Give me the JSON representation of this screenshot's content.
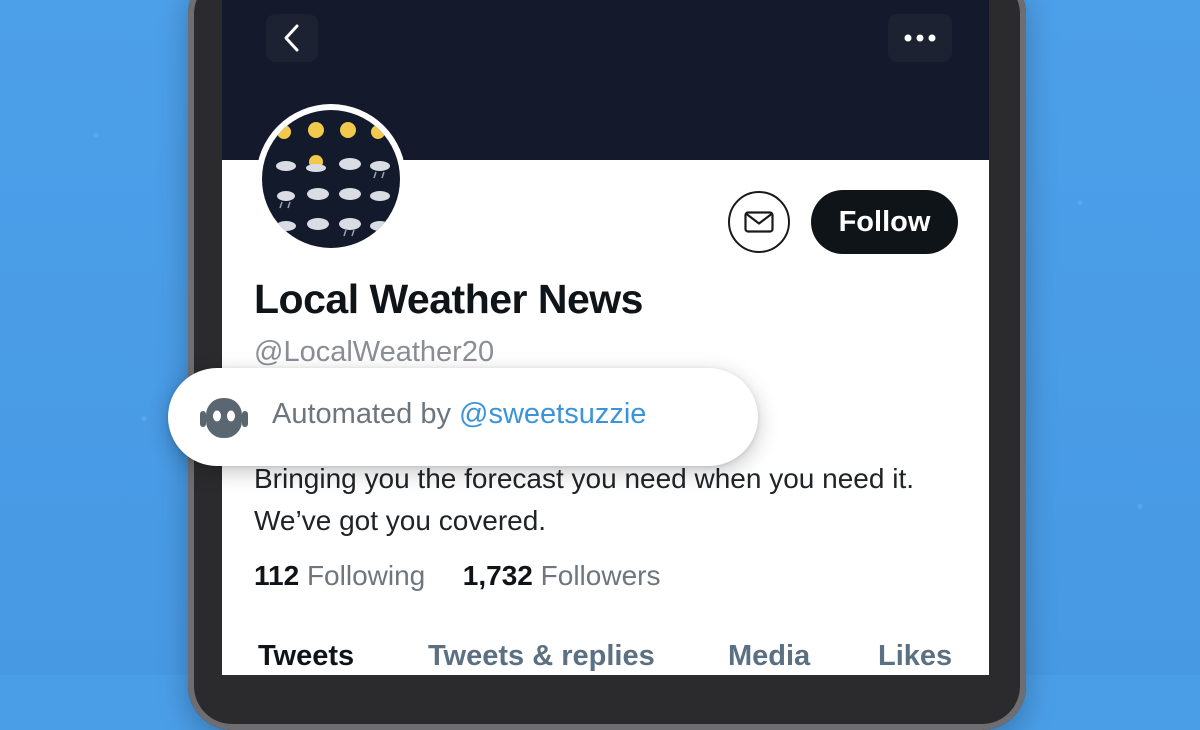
{
  "profile": {
    "name": "Local Weather News",
    "handle": "@LocalWeather20",
    "bio": "Bringing you the forecast you need when you need it.  We’ve got you covered.",
    "follow_label": "Follow"
  },
  "automated": {
    "prefix": "Automated by ",
    "owner": "@sweetsuzzie"
  },
  "stats": {
    "following_count": "112",
    "following_label": "Following",
    "followers_count": "1,732",
    "followers_label": "Followers"
  },
  "tabs": [
    {
      "label": "Tweets",
      "active": true
    },
    {
      "label": "Tweets & replies",
      "active": false
    },
    {
      "label": "Media",
      "active": false
    },
    {
      "label": "Likes",
      "active": false
    }
  ],
  "icons": {
    "back": "chevron-left-icon",
    "more": "more-dots-icon",
    "message": "mail-icon",
    "bot": "robot-icon"
  },
  "colors": {
    "header_bg": "#141a2b",
    "link": "#3b94d9",
    "follow_bg": "#0f1419",
    "background": "#4a9ee8"
  }
}
